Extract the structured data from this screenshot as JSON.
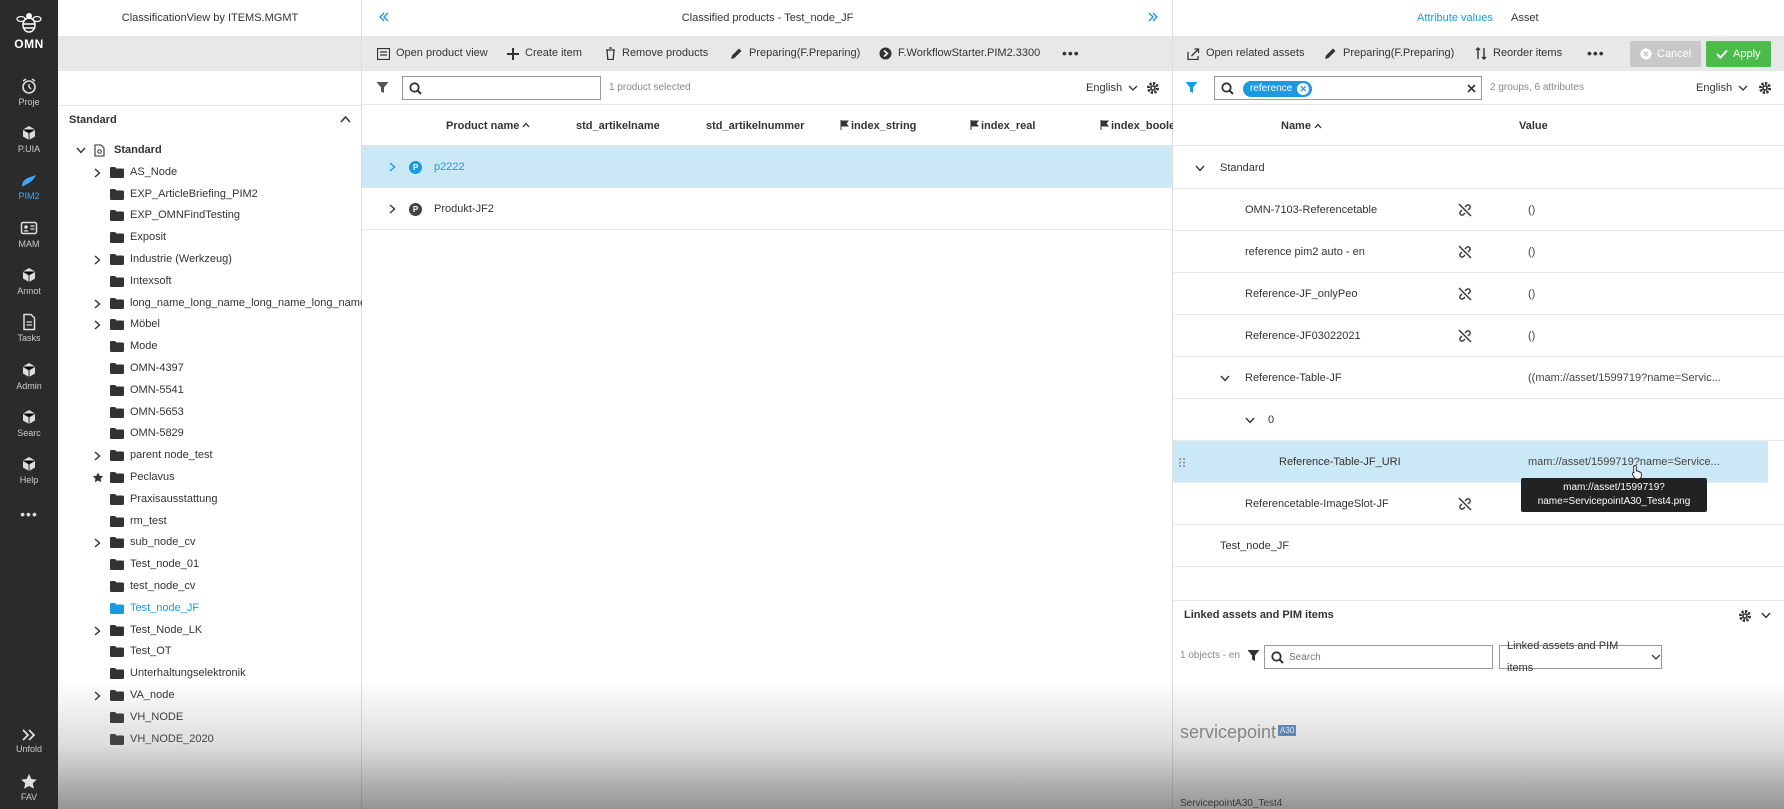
{
  "rail": {
    "logo": "OMN",
    "items": [
      {
        "label": "Proje",
        "icon": "alarm-clock-icon"
      },
      {
        "label": "P.UIA",
        "icon": "cube-icon"
      },
      {
        "label": "PIM2",
        "icon": "leaf-icon"
      },
      {
        "label": "MAM",
        "icon": "id-card-icon"
      },
      {
        "label": "Annot",
        "icon": "cube-icon"
      },
      {
        "label": "Tasks",
        "icon": "document-icon"
      },
      {
        "label": "Admin",
        "icon": "cube-icon"
      },
      {
        "label": "Searc",
        "icon": "cube-icon"
      },
      {
        "label": "Help",
        "icon": "cube-icon"
      }
    ],
    "more": "•••",
    "unfold": "Unfold",
    "fav": "FAV"
  },
  "left": {
    "title": "ClassificationView by ITEMS.MGMT",
    "section": "Standard",
    "root": "Standard",
    "nodes": [
      {
        "label": "AS_Node",
        "expand": true
      },
      {
        "label": "EXP_ArticleBriefing_PIM2",
        "expand": false
      },
      {
        "label": "EXP_OMNFindTesting",
        "expand": false
      },
      {
        "label": "Exposit",
        "expand": false
      },
      {
        "label": "Industrie (Werkzeug)",
        "expand": true
      },
      {
        "label": "Intexsoft",
        "expand": false
      },
      {
        "label": "long_name_long_name_long_name_long_name_",
        "expand": true
      },
      {
        "label": "Möbel",
        "expand": true
      },
      {
        "label": "Mode",
        "expand": false
      },
      {
        "label": "OMN-4397",
        "expand": false
      },
      {
        "label": "OMN-5541",
        "expand": false
      },
      {
        "label": "OMN-5653",
        "expand": false
      },
      {
        "label": "OMN-5829",
        "expand": false
      },
      {
        "label": "parent node_test",
        "expand": true
      },
      {
        "label": "Peclavus",
        "expand": false,
        "star": true
      },
      {
        "label": "Praxisausstattung",
        "expand": false
      },
      {
        "label": "rm_test",
        "expand": false
      },
      {
        "label": "sub_node_cv",
        "expand": true
      },
      {
        "label": "Test_node_01",
        "expand": false
      },
      {
        "label": "test_node_cv",
        "expand": false
      },
      {
        "label": "Test_node_JF",
        "expand": false,
        "selected": true
      },
      {
        "label": "Test_Node_LK",
        "expand": true
      },
      {
        "label": "Test_OT",
        "expand": false
      },
      {
        "label": "Unterhaltungselektronik",
        "expand": false
      },
      {
        "label": "VA_node",
        "expand": true
      },
      {
        "label": "VH_NODE",
        "expand": false
      },
      {
        "label": "VH_NODE_2020",
        "expand": false
      }
    ]
  },
  "mid": {
    "title": "Classified products - Test_node_JF",
    "toolbar": {
      "open_product_view": "Open product view",
      "create_item": "Create item",
      "remove_products": "Remove products",
      "preparing": "Preparing(F.Preparing)",
      "workflow": "F.WorkflowStarter.PIM2.3300",
      "more": "•••"
    },
    "search_placeholder": "",
    "selection_info": "1 product selected",
    "language": "English",
    "columns": [
      "Product name",
      "std_artikelname",
      "std_artikelnummer",
      "index_string",
      "index_real",
      "index_boole"
    ],
    "rows": [
      {
        "name": "p2222",
        "badge": "P",
        "selected": true
      },
      {
        "name": "Produkt-JF2",
        "badge": "P",
        "selected": false
      }
    ]
  },
  "right": {
    "tabs": {
      "attribute_values": "Attribute values",
      "asset": "Asset"
    },
    "toolbar": {
      "open_related_assets": "Open related assets",
      "preparing": "Preparing(F.Preparing)",
      "reorder_items": "Reorder items",
      "more": "•••",
      "cancel": "Cancel",
      "apply": "Apply"
    },
    "filter_chip": "reference",
    "summary": "2 groups, 6 attributes",
    "language": "English",
    "col_name": "Name",
    "col_value": "Value",
    "rows": [
      {
        "name": "Standard",
        "value": "",
        "indent": 0,
        "chev": "down",
        "unlink": false
      },
      {
        "name": "OMN-7103-Referencetable",
        "value": "()",
        "indent": 2,
        "chev": "",
        "unlink": true
      },
      {
        "name": "reference pim2 auto - en",
        "value": "()",
        "indent": 2,
        "chev": "",
        "unlink": true
      },
      {
        "name": "Reference-JF_onlyPeo",
        "value": "()",
        "indent": 2,
        "chev": "",
        "unlink": true
      },
      {
        "name": "Reference-JF03022021",
        "value": "()",
        "indent": 2,
        "chev": "",
        "unlink": true
      },
      {
        "name": "Reference-Table-JF",
        "value": "((mam://asset/1599719?name=Servic...",
        "indent": 1,
        "chev": "down",
        "unlink": false
      },
      {
        "name": "0",
        "value": "",
        "indent": 2,
        "chev": "down",
        "unlink": false
      },
      {
        "name": "Reference-Table-JF_URI",
        "value": "mam://asset/1599719?name=Service...",
        "indent": 3,
        "chev": "",
        "unlink": false,
        "selected": true
      },
      {
        "name": "Referencetable-ImageSlot-JF",
        "value": "",
        "indent": 2,
        "chev": "",
        "unlink": true
      },
      {
        "name": "Test_node_JF",
        "value": "",
        "indent": 0,
        "chev": "",
        "unlink": false
      }
    ],
    "tooltip_line1": "mam://asset/1599719?",
    "tooltip_line2": "name=ServicepointA30_Test4.png",
    "linked": {
      "title": "Linked assets and PIM items",
      "count": "1 objects - en",
      "search_placeholder": "Search",
      "dropdown": "Linked assets and PIM items",
      "logo_text": "servicepoint",
      "logo_badge": "A30",
      "caption": "ServicepointA30_Test4"
    }
  }
}
